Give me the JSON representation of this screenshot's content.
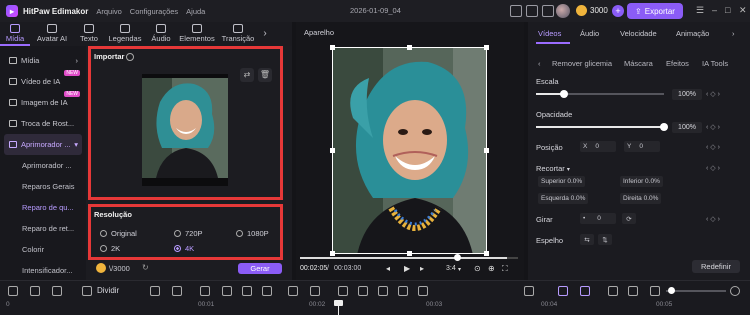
{
  "titlebar": {
    "app_name": "HitPaw Edimakor",
    "menus": [
      "Arquivo",
      "Configurações",
      "Ajuda"
    ],
    "project_name": "2026-01-09_04",
    "credits": "3000",
    "export_label": "Exportar"
  },
  "top_tabs": [
    {
      "label": "Mídia",
      "icon": "media-icon"
    },
    {
      "label": "Avatar AI",
      "icon": "avatar-icon"
    },
    {
      "label": "Texto",
      "icon": "text-icon"
    },
    {
      "label": "Legendas",
      "icon": "subtitles-icon"
    },
    {
      "label": "Áudio",
      "icon": "audio-icon"
    },
    {
      "label": "Elementos",
      "icon": "elements-icon"
    },
    {
      "label": "Transição",
      "icon": "transition-icon"
    }
  ],
  "sidebar": {
    "items": [
      {
        "label": "Mídia",
        "new": false
      },
      {
        "label": "Vídeo de IA",
        "new": true
      },
      {
        "label": "Imagem de IA",
        "new": true
      },
      {
        "label": "Troca de Rost...",
        "new": false
      },
      {
        "label": "Aprimorador ...",
        "new": false
      }
    ],
    "sub_items": [
      "Aprimorador ...",
      "Reparos Gerais",
      "Reparo de qu...",
      "Reparo de ret...",
      "Colorir",
      "Intensificador..."
    ]
  },
  "enhancer": {
    "import_title": "Importar",
    "resolution_title": "Resolução",
    "options": [
      "Original",
      "720P",
      "1080P",
      "2K",
      "4K"
    ],
    "selected": "4K",
    "credits_value": "\\/3000",
    "generate_label": "Gerar"
  },
  "preview": {
    "title": "Aparelho",
    "current_time": "00:02:05",
    "total_time": "00:03:00",
    "separator": "/",
    "aspect": "3:4",
    "progress": 0.95
  },
  "properties": {
    "tabs": [
      "Vídeos",
      "Áudio",
      "Velocidade",
      "Animação"
    ],
    "subtabs": [
      "Remover glicemia",
      "Máscara",
      "Efeitos",
      "IA Tools"
    ],
    "scale_label": "Escala",
    "scale_value": "100%",
    "opacity_label": "Opacidade",
    "opacity_value": "100%",
    "position_label": "Posição",
    "x_label": "X",
    "x_value": "0",
    "y_label": "Y",
    "y_value": "0",
    "crop_label": "Recortar",
    "crop_top": "Superior 0.0%",
    "crop_bottom": "Inferior 0.0%",
    "crop_left": "Esquerda 0.0%",
    "crop_right": "Direita 0.0%",
    "rotate_label": "Girar",
    "rotate_value": "0",
    "mirror_label": "Espelho",
    "reset_label": "Redefinir"
  },
  "timeline": {
    "split_label": "Dividir",
    "ticks": [
      "0",
      "00:01",
      "00:02",
      "00:03",
      "00:04",
      "00:05"
    ]
  }
}
